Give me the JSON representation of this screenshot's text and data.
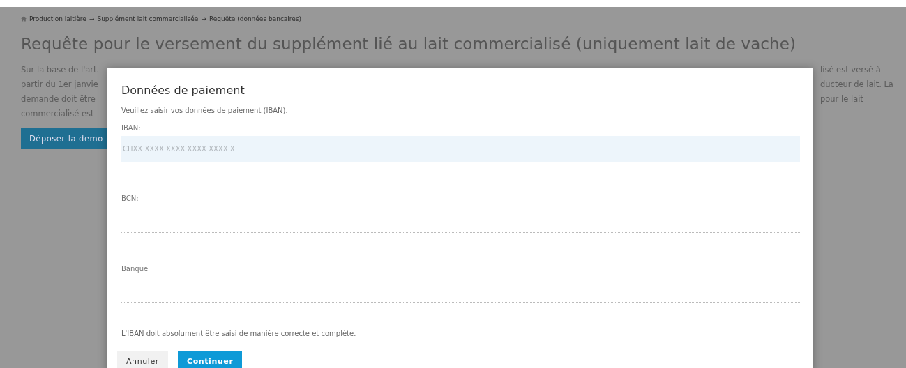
{
  "breadcrumb": [
    "Production laitière",
    "Supplément lait commercialisée",
    "Requête (données bancaires)"
  ],
  "breadcrumb_separator": "→",
  "page_title": "Requête pour le versement du supplément lié au lait commercialisé (uniquement lait de vache)",
  "intro_left_lines": [
    "Sur la base de l'art.",
    "partir du 1er janvie",
    "demande doit être",
    "commercialisé est"
  ],
  "intro_right_lines": [
    "lisé est versé à",
    "ducteur de lait. La",
    "pour le lait"
  ],
  "submit_button": "Déposer la demo",
  "dialog": {
    "title": "Données de paiement",
    "instruction": "Veuillez saisir vos données de paiement (IBAN).",
    "fields": [
      {
        "label": "IBAN:",
        "placeholder": "CHXX XXXX XXXX XXXX XXXX X",
        "focused": true
      },
      {
        "label": "BCN:",
        "focused": false
      },
      {
        "label": "Banque",
        "focused": false
      }
    ],
    "note": "L'IBAN doit absolument être saisi de manière correcte et complète.",
    "buttons": [
      {
        "label": "Annuler",
        "kind": "secondary"
      },
      {
        "label": "Continuer",
        "kind": "primary"
      }
    ]
  }
}
